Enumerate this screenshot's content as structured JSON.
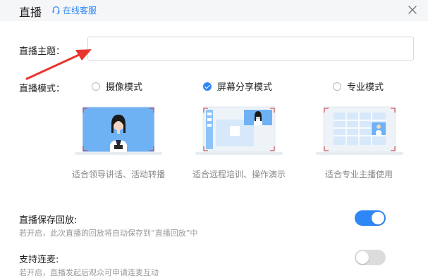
{
  "header": {
    "title": "直播",
    "service_link": "在线客服",
    "service_icon": "headset-icon",
    "close_icon": "close-icon"
  },
  "form": {
    "topic_label": "直播主题：",
    "topic_value": "",
    "topic_placeholder": "",
    "mode_label": "直播模式："
  },
  "modes": [
    {
      "label": "摄像模式",
      "desc": "适合领导讲话、活动转播",
      "selected": false
    },
    {
      "label": "屏幕分享模式",
      "desc": "适合远程培训、操作演示",
      "selected": true
    },
    {
      "label": "专业模式",
      "desc": "适合专业主播使用",
      "selected": false
    }
  ],
  "settings": {
    "save_playback": {
      "title": "直播保存回放:",
      "desc": "若开启，此次直播的回放将自动保存到“直播回放”中",
      "enabled": true
    },
    "co_host": {
      "title": "支持连麦:",
      "desc": "若开启，直播发起后观众可申请连麦互动",
      "enabled": false
    }
  },
  "colors": {
    "accent": "#2f86f6",
    "arrow": "#e8362c",
    "toggle_off": "#dcdcdc"
  }
}
